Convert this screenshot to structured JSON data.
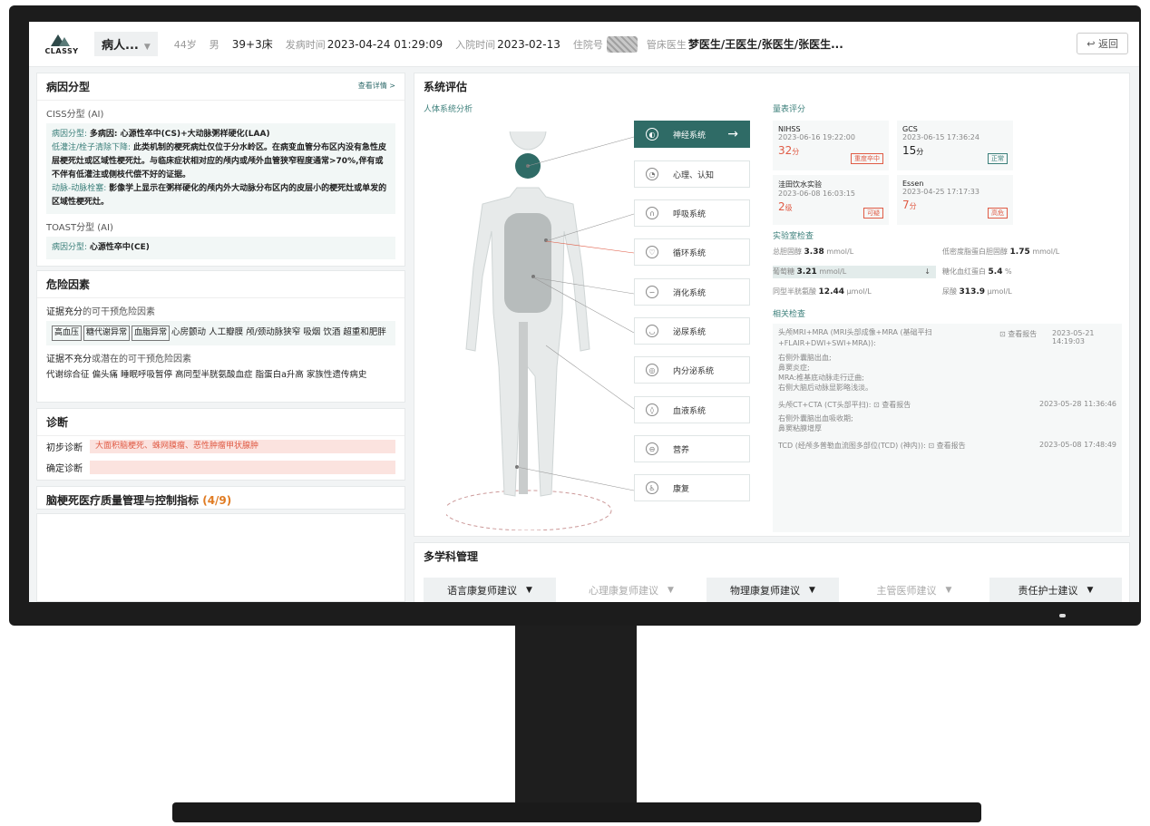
{
  "header": {
    "logo_text": "CLASSY",
    "patient_name": "病人...",
    "age": "44岁",
    "gender": "男",
    "bed": "39+3床",
    "onset_label": "发病时间",
    "onset_time": "2023-04-24 01:29:09",
    "admit_label": "入院时间",
    "admit_date": "2023-02-13",
    "hosp_no_label": "住院号",
    "doctor_label": "管床医生",
    "doctors": "梦医生/王医生/张医生/张医生...",
    "back_label": "返回"
  },
  "etiology": {
    "title": "病因分型",
    "more": "查看详情 >",
    "ciss_title": "CISS分型 (AI)",
    "ciss_type_k": "病因分型:",
    "ciss_type_v": "多病因: 心源性卒中(CS)+大动脉粥样硬化(LAA)",
    "ciss_low_k": "低灌注/栓子清除下降:",
    "ciss_low_v": "此类机制的梗死病灶仅位于分水岭区。在病变血管分布区内没有急性皮层梗死灶或区域性梗死灶。与临床症状相对应的颅内或颅外血管狭窄程度通常>70%,伴有或不伴有低灌注或侧枝代偿不好的证据。",
    "ciss_art_k": "动脉-动脉栓塞:",
    "ciss_art_v": "影像学上显示在粥样硬化的颅内外大动脉分布区内的皮层小的梗死灶或单发的区域性梗死灶。",
    "toast_title": "TOAST分型 (AI)",
    "toast_k": "病因分型:",
    "toast_v": "心源性卒中(CE)"
  },
  "risk": {
    "title": "危险因素",
    "sufficient_label": "证据充分",
    "sufficient_suffix": "的可干预危险因素",
    "tags": [
      "高血压",
      "糖代谢异常",
      "血脂异常"
    ],
    "sufficient_rest": "心房颤动 人工瓣膜 颅/颈动脉狭窄 吸烟 饮酒 超重和肥胖",
    "insufficient_label": "证据不充分",
    "insufficient_suffix": "或潜在的可干预危险因素",
    "insufficient_items": "代谢综合征 偏头痛 睡眠呼吸暂停 高同型半胱氨酸血症 脂蛋白a升高 家族性遗传病史"
  },
  "diagnosis": {
    "title": "诊断",
    "initial_label": "初步诊断",
    "initial_value": "大面积脑梗死、蛛网膜瘤、恶性肿瘤甲状腺肿",
    "confirm_label": "确定诊断",
    "confirm_value": ""
  },
  "quality": {
    "title": "脑梗死医疗质量管理与控制指标",
    "count": "(4/9)"
  },
  "system": {
    "title": "系统评估",
    "body_label": "人体系统分析",
    "buttons": [
      "神经系统",
      "心理、认知",
      "呼吸系统",
      "循环系统",
      "消化系统",
      "泌尿系统",
      "内分泌系统",
      "血液系统",
      "营养",
      "康复"
    ],
    "scale_title": "量表评分",
    "scales": [
      {
        "name": "NIHSS",
        "time": "2023-06-16 19:22:00",
        "value": "32",
        "unit": "分",
        "badge": "重度卒中"
      },
      {
        "name": "GCS",
        "time": "2023-06-15 17:36:24",
        "value": "15",
        "unit": "分",
        "badge": "正常"
      },
      {
        "name": "洼田饮水实验",
        "time": "2023-06-08 16:03:15",
        "value": "2",
        "unit": "级",
        "badge": "可疑"
      },
      {
        "name": "Essen",
        "time": "2023-04-25 17:17:33",
        "value": "7",
        "unit": "分",
        "badge": "高危"
      }
    ],
    "lab_title": "实验室检查",
    "labs": [
      {
        "name": "总胆固醇",
        "value": "3.38",
        "unit": "mmol/L"
      },
      {
        "name": "低密度脂蛋白胆固醇",
        "value": "1.75",
        "unit": "mmol/L"
      },
      {
        "name": "葡萄糖",
        "value": "3.21",
        "unit": "mmol/L"
      },
      {
        "name": "糖化血红蛋白",
        "value": "5.4",
        "unit": "%"
      },
      {
        "name": "同型半胱氨酸",
        "value": "12.44",
        "unit": "μmol/L"
      },
      {
        "name": "尿酸",
        "value": "313.9",
        "unit": "μmol/L"
      }
    ],
    "related_title": "相关检查",
    "related": [
      {
        "name": "头颅MRI+MRA (MRI头部成像+MRA (基础平扫+FLAIR+DWI+SWI+MRA)):",
        "time": "2023-05-21 14:19:03",
        "btn": "查看报告",
        "result": "右侧外囊脑出血;\n鼻窦炎症;\nMRA:椎基底动脉走行迂曲;\n右侧大脑后动脉显影略浅淡。"
      },
      {
        "name": "头颅CT+CTA (CT头部平扫):",
        "time": "2023-05-28 11:36:46",
        "btn": "查看报告",
        "result": "右侧外囊脑出血吸收期;\n鼻窦粘膜增厚"
      },
      {
        "name": "TCD (经颅多普勒血流图多部位(TCD) (神内)):",
        "time": "2023-05-08 17:48:49",
        "btn": "查看报告",
        "result": ""
      }
    ]
  },
  "multi": {
    "title": "多学科管理",
    "tabs": [
      "语言康复师建议",
      "心理康复师建议",
      "物理康复师建议",
      "主管医师建议",
      "责任护士建议"
    ]
  }
}
